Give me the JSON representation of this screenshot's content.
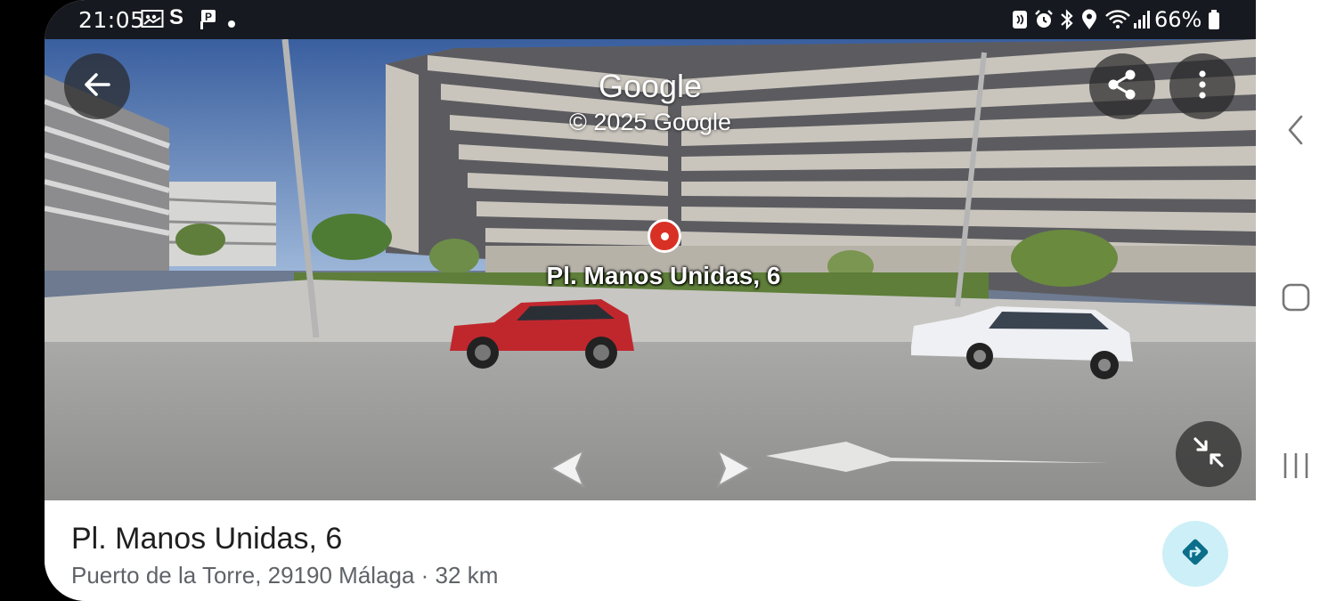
{
  "status_bar": {
    "time": "21:05",
    "battery": "66%",
    "left_icons": [
      "gallery-icon",
      "s-app-icon",
      "parking-icon",
      "dot-icon"
    ],
    "right_icons": [
      "nfc-icon",
      "alarm-icon",
      "bluetooth-icon",
      "location-icon",
      "wifi-icon",
      "signal-icon",
      "battery-icon"
    ]
  },
  "street_view": {
    "brand": "Google",
    "copyright": "© 2025 Google",
    "place_label": "Pl. Manos Unidas, 6",
    "controls": [
      "back-arrow-icon",
      "share-icon",
      "more-vert-icon",
      "minimize-icon"
    ]
  },
  "info_card": {
    "title": "Pl. Manos Unidas, 6",
    "subtitle": "Puerto de la Torre, 29190 Málaga · 32 km"
  },
  "nav_bar": {
    "keys": [
      "back-icon",
      "home-icon",
      "recents-icon"
    ]
  },
  "colors": {
    "pin": "#d93025",
    "directions_bg": "#cdeff7",
    "directions_icon": "#0b6e8a",
    "status_bar": "#16191f"
  }
}
